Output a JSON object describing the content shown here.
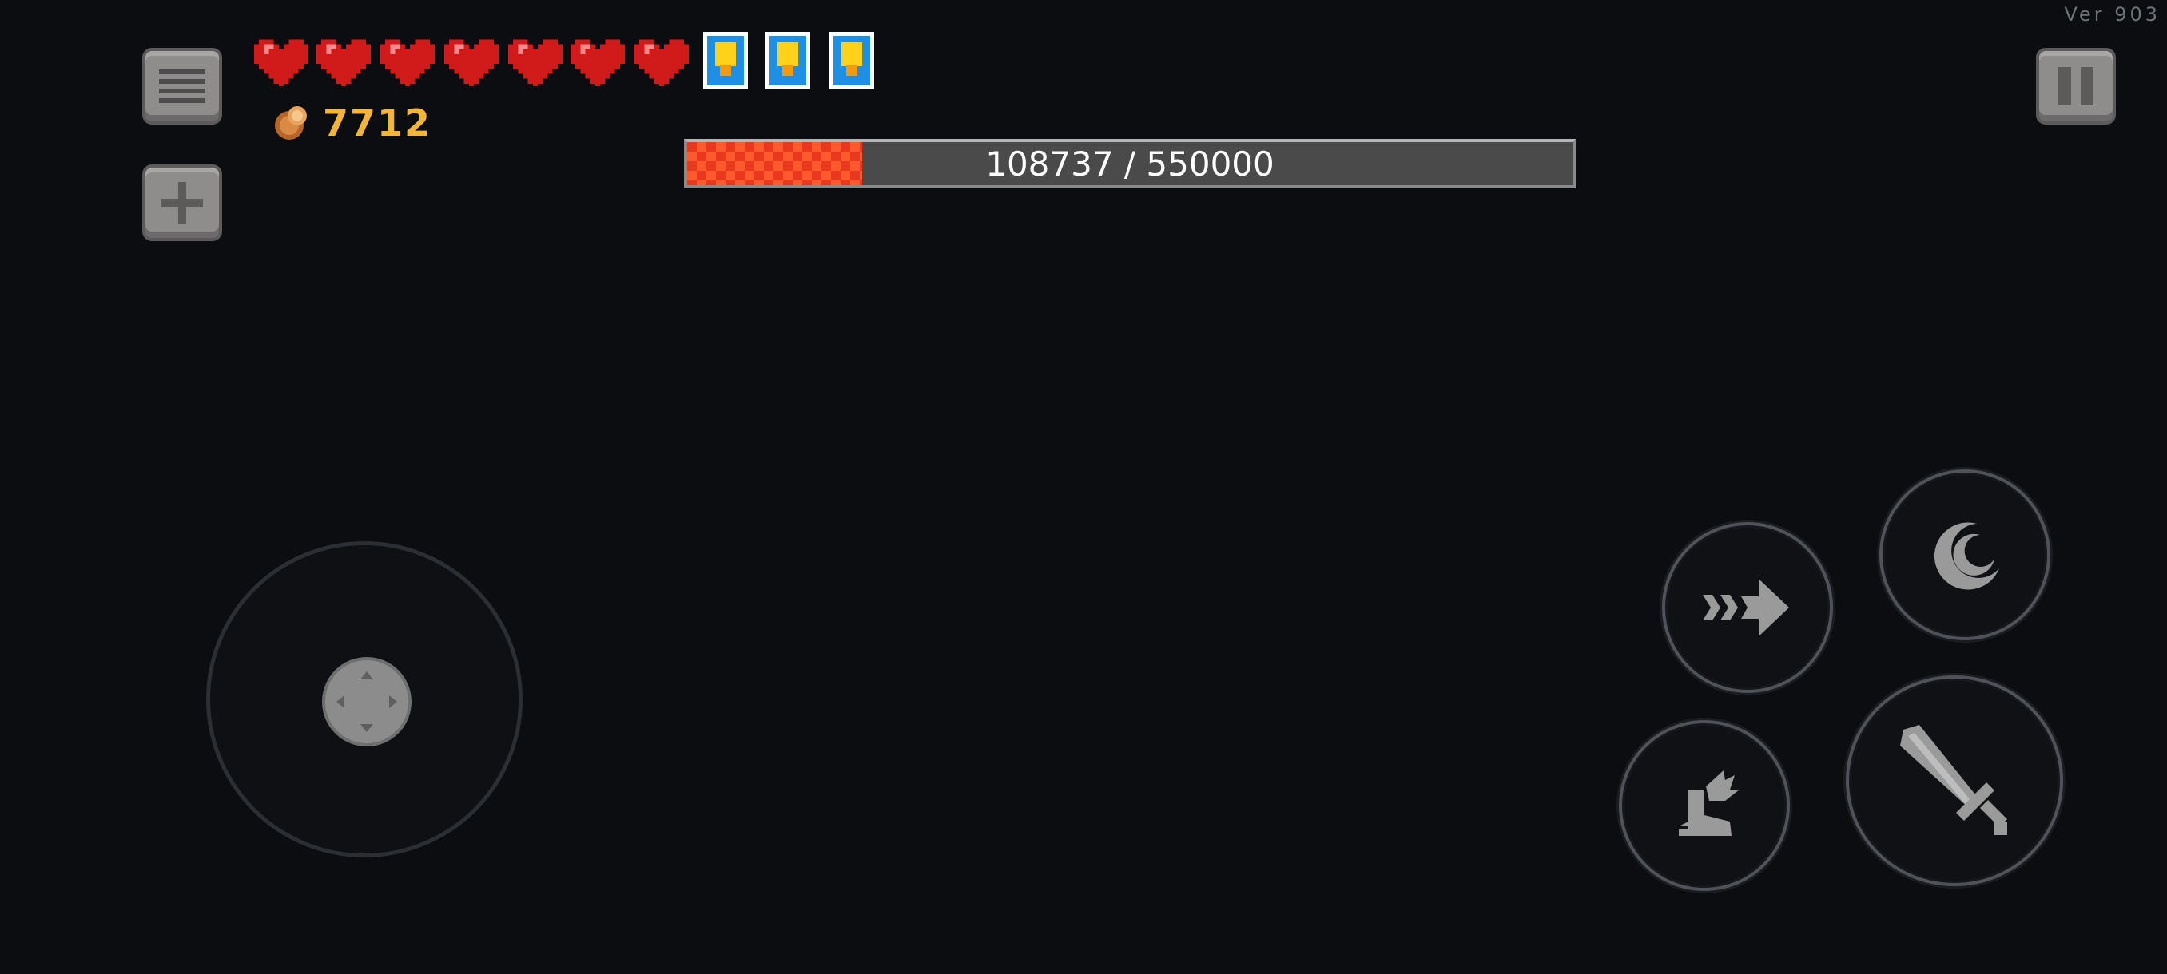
{
  "version_label": "Ver 903",
  "hud": {
    "hearts": {
      "count": 7,
      "icon": "heart-icon",
      "color": "#d11a1a"
    },
    "shields": {
      "count": 3,
      "icon": "shield-icon",
      "color": "#1e8fe6"
    },
    "coins": {
      "icon": "coin-icon",
      "value": "7712",
      "color": "#f1b53a"
    }
  },
  "boss_health": {
    "current": 108737,
    "max": 550000,
    "label": "108737 / 550000",
    "fill_color": "#e8391e"
  },
  "buttons": {
    "menu": {
      "icon": "menu-icon"
    },
    "add": {
      "icon": "plus-icon"
    },
    "pause": {
      "icon": "pause-icon"
    },
    "dash": {
      "icon": "dash-arrow-icon"
    },
    "special": {
      "icon": "crescent-moon-icon"
    },
    "jump": {
      "icon": "winged-boot-icon"
    },
    "attack": {
      "icon": "sword-icon"
    }
  },
  "joystick": {
    "icon": "dpad-icon"
  }
}
